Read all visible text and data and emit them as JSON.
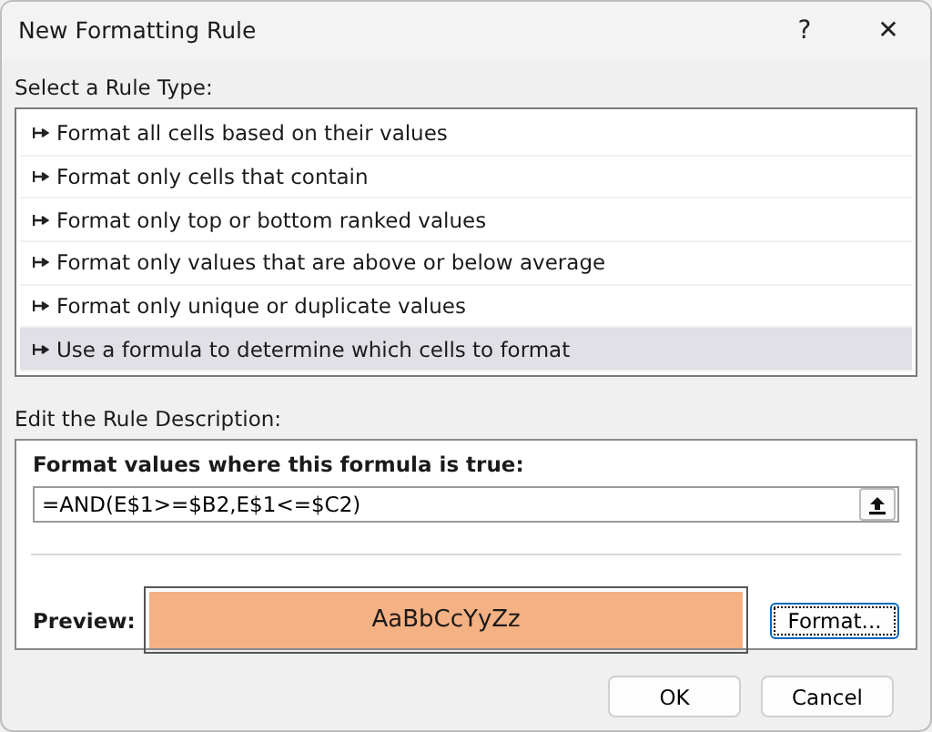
{
  "window": {
    "title": "New Formatting Rule",
    "help": "?",
    "close": "✕"
  },
  "rule_type": {
    "label": "Select a Rule Type:",
    "items": [
      {
        "label": "Format all cells based on their values",
        "selected": false
      },
      {
        "label": "Format only cells that contain",
        "selected": false
      },
      {
        "label": "Format only top or bottom ranked values",
        "selected": false
      },
      {
        "label": "Format only values that are above or below average",
        "selected": false
      },
      {
        "label": "Format only unique or duplicate values",
        "selected": false
      },
      {
        "label": "Use a formula to determine which cells to format",
        "selected": true
      }
    ]
  },
  "description": {
    "label": "Edit the Rule Description:",
    "formula_label": "Format values where this formula is true:",
    "formula": "=AND(E$1>=$B2,E$1<=$C2)",
    "preview_label": "Preview:",
    "preview_text": "AaBbCcYyZz",
    "format_button": "Format..."
  },
  "buttons": [
    "OK",
    "Cancel"
  ]
}
